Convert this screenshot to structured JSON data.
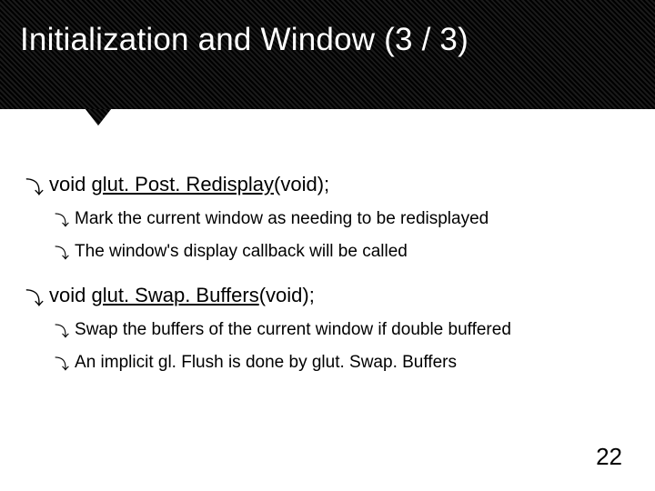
{
  "title": "Initialization and Window (3 / 3)",
  "items": [
    {
      "prefix": "void ",
      "func": "glut. Post. Redisplay",
      "suffix": "(void);",
      "sub": [
        "Mark the current window as needing to be redisplayed",
        "The window's display callback will be called"
      ]
    },
    {
      "prefix": "void ",
      "func": "glut. Swap. Buffers",
      "suffix": "(void);",
      "sub": [
        "Swap the buffers of the current window if double buffered",
        "An implicit gl. Flush is done by glut. Swap. Buffers"
      ]
    }
  ],
  "page": "22",
  "bullet_glyph": "⤵"
}
